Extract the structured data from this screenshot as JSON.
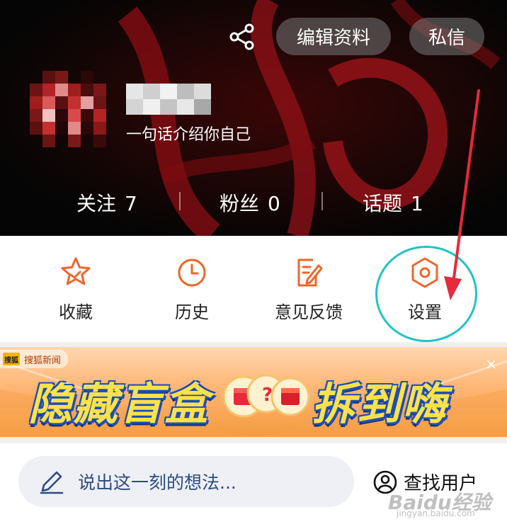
{
  "header": {
    "edit_profile_label": "编辑资料",
    "message_label": "私信",
    "bio": "一句话介绍你自己",
    "stats": [
      {
        "label": "关注",
        "value": "7"
      },
      {
        "label": "粉丝",
        "value": "0"
      },
      {
        "label": "话题",
        "value": "1"
      }
    ]
  },
  "actions": [
    {
      "label": "收藏",
      "icon": "star-icon"
    },
    {
      "label": "历史",
      "icon": "clock-icon"
    },
    {
      "label": "意见反馈",
      "icon": "feedback-edit-icon"
    },
    {
      "label": "设置",
      "icon": "hexagon-settings-icon"
    }
  ],
  "banner": {
    "source": "搜狐新闻",
    "logo_text": "搜狐",
    "headline_left": "隐藏盲盒",
    "headline_right": "拆到嗨",
    "close_symbol": "×"
  },
  "bottom": {
    "post_placeholder": "说出这一刻的想法...",
    "find_user_label": "查找用户"
  },
  "watermark": {
    "text": "Baidu经验",
    "url_text": "jingyan.baidu.com"
  },
  "colors": {
    "accent": "#f0652a",
    "highlight": "#22c3c4",
    "arrow": "#e8283b"
  }
}
